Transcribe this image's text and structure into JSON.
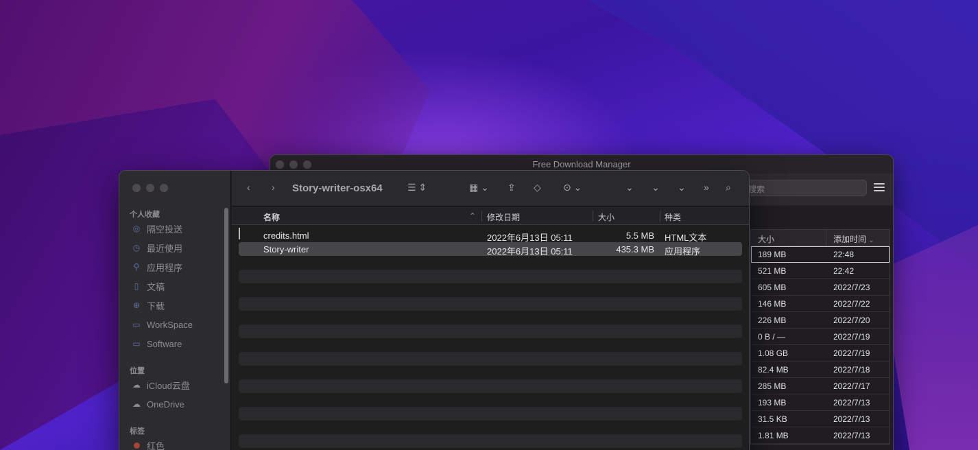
{
  "fdm": {
    "title": "Free Download Manager",
    "search_placeholder": "搜索",
    "columns": {
      "size": "大小",
      "added": "添加时间"
    },
    "rows": [
      {
        "size": "189 MB",
        "added": "22:48"
      },
      {
        "size": "521 MB",
        "added": "22:42"
      },
      {
        "size": "605 MB",
        "added": "2022/7/23"
      },
      {
        "size": "146 MB",
        "added": "2022/7/22"
      },
      {
        "size": "226 MB",
        "added": "2022/7/20"
      },
      {
        "size": "0 B / —",
        "added": "2022/7/19"
      },
      {
        "size": "1.08 GB",
        "added": "2022/7/19"
      },
      {
        "size": "82.4 MB",
        "added": "2022/7/18"
      },
      {
        "size": "285 MB",
        "added": "2022/7/17"
      },
      {
        "size": "193 MB",
        "added": "2022/7/13"
      },
      {
        "size": "31.5 KB",
        "added": "2022/7/13"
      },
      {
        "size": "1.81 MB",
        "added": "2022/7/13"
      }
    ]
  },
  "finder": {
    "folder_title": "Story-writer-osx64",
    "sidebar": {
      "favorites_header": "个人收藏",
      "favorites": [
        "隔空投送",
        "最近使用",
        "应用程序",
        "文稿",
        "下载",
        "WorkSpace",
        "Software"
      ],
      "locations_header": "位置",
      "locations": [
        "iCloud云盘",
        "OneDrive"
      ],
      "tags_header": "标签",
      "tags": [
        "红色"
      ]
    },
    "columns": {
      "name": "名称",
      "modified": "修改日期",
      "size": "大小",
      "kind": "种类"
    },
    "files": [
      {
        "name": "credits.html",
        "modified": "2022年6月13日 05:11",
        "size": "5.5 MB",
        "kind": "HTML文本"
      },
      {
        "name": "Story-writer",
        "modified": "2022年6月13日 05:11",
        "size": "435.3 MB",
        "kind": "应用程序"
      }
    ]
  }
}
